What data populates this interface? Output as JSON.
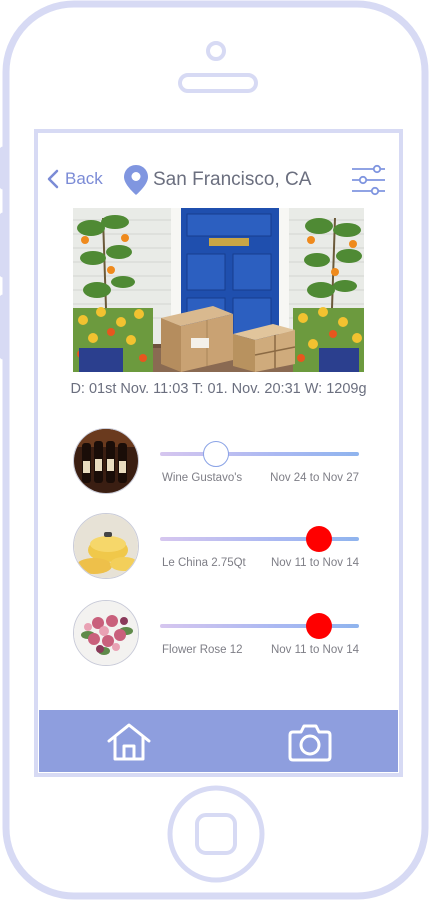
{
  "header": {
    "back_label": "Back",
    "location": "San Francisco, CA"
  },
  "hero": {
    "alt": "parcels at front door"
  },
  "delivery": {
    "summary": "D: 01st Nov. 11:03  T: 01. Nov. 20:31  W: 1209g"
  },
  "items": [
    {
      "name": "Wine Gustavo's",
      "range": "Nov 24 to Nov 27",
      "level": 0.28,
      "state": "open"
    },
    {
      "name": "Le China 2.75Qt",
      "range": "Nov 11 to Nov 14",
      "level": 0.8,
      "state": "closed"
    },
    {
      "name": "Flower Rose 12",
      "range": "Nov 11 to Nov 14",
      "level": 0.8,
      "state": "closed"
    }
  ],
  "tabbar": {
    "home": "home-icon",
    "camera": "camera-icon"
  },
  "colors": {
    "accent": "#8e9ede",
    "knob_closed": "#ff0000",
    "text": "#6b6f7f"
  }
}
